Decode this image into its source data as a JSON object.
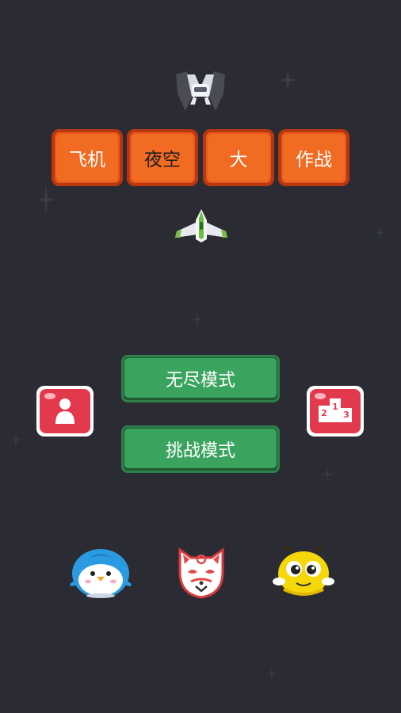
{
  "title": {
    "words": [
      "飞机",
      "夜空",
      "大",
      "作战"
    ]
  },
  "menu": {
    "endless_label": "无尽模式",
    "challenge_label": "挑战模式"
  },
  "buttons": {
    "profile_icon": "person-icon",
    "leaderboard_icon": "podium-icon",
    "podium_numbers": [
      "1",
      "2",
      "3"
    ]
  },
  "characters": [
    "penguin",
    "fox-mask",
    "bee"
  ],
  "colors": {
    "background": "#2b2c33",
    "title_tile": "#f26b22",
    "mode_button": "#3aa45f",
    "red_button": "#e23a4c"
  }
}
